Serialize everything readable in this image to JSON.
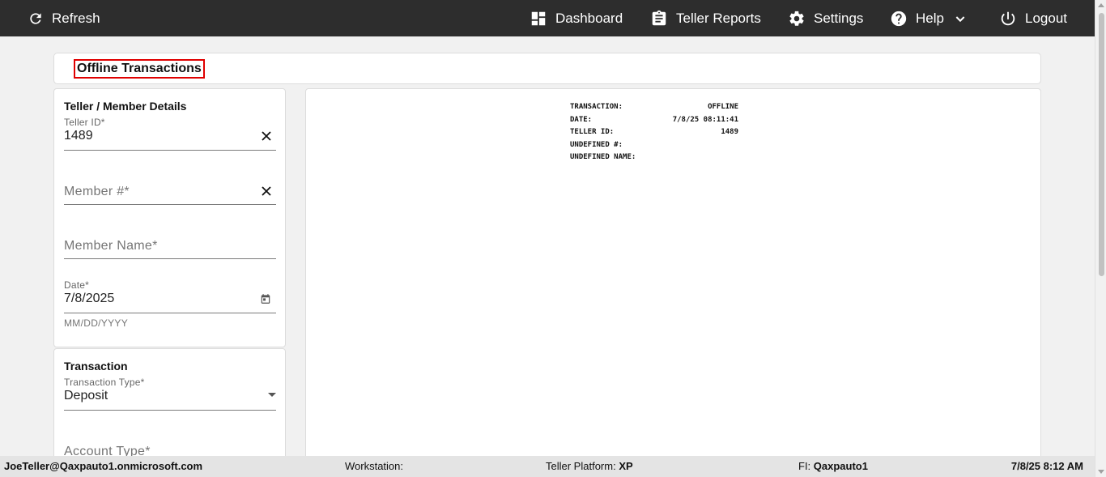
{
  "topbar": {
    "refresh": "Refresh",
    "dashboard": "Dashboard",
    "teller_reports": "Teller Reports",
    "settings": "Settings",
    "help": "Help",
    "logout": "Logout"
  },
  "page": {
    "title": "Offline Transactions"
  },
  "member_card": {
    "title": "Teller / Member Details",
    "teller_id_label": "Teller ID*",
    "teller_id_value": "1489",
    "member_number_placeholder": "Member #*",
    "member_name_placeholder": "Member Name*",
    "date_label": "Date*",
    "date_value": "7/8/2025",
    "date_helper": "MM/DD/YYYY"
  },
  "transaction_card": {
    "title": "Transaction",
    "type_label": "Transaction Type*",
    "type_value": "Deposit",
    "account_type_placeholder": "Account Type*"
  },
  "receipt": {
    "lines": [
      {
        "label": "TRANSACTION:",
        "value": "OFFLINE"
      },
      {
        "label": "DATE:",
        "value": "7/8/25 08:11:41"
      },
      {
        "label": "TELLER ID:",
        "value": "1489"
      },
      {
        "label": "UNDEFINED #:",
        "value": ""
      },
      {
        "label": "UNDEFINED NAME:",
        "value": ""
      }
    ]
  },
  "statusbar": {
    "user": "JoeTeller@Qaxpauto1.onmicrosoft.com",
    "workstation_label": "Workstation:",
    "workstation_value": "",
    "platform_label": "Teller Platform:",
    "platform_value": "XP",
    "fi_label": "FI:",
    "fi_value": "Qaxpauto1",
    "datetime": "7/8/25 8:12 AM"
  }
}
